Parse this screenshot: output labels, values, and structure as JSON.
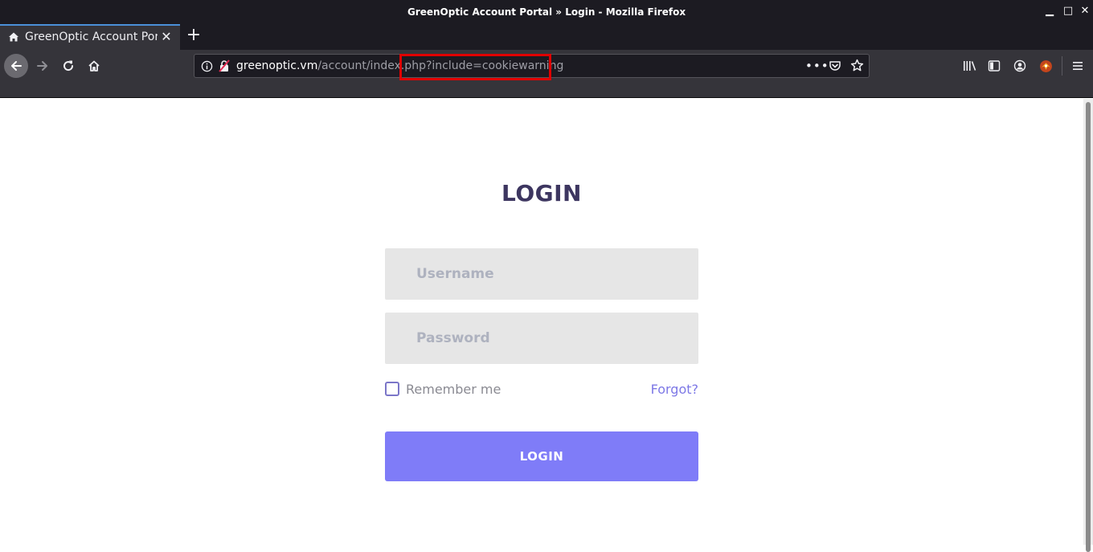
{
  "window": {
    "title": "GreenOptic Account Portal » Login - Mozilla Firefox",
    "minimize": "▁",
    "maximize": "□",
    "close": "✕"
  },
  "tab": {
    "title": "GreenOptic Account Portal » Login",
    "favicon": "home-icon",
    "close": "✕",
    "new_tab": "+"
  },
  "urlbar": {
    "host": "greenoptic.vm",
    "path": "/account/index.php?include=cookiewarning",
    "page_actions": "•••"
  },
  "page": {
    "title": "LOGIN",
    "username_placeholder": "Username",
    "password_placeholder": "Password",
    "remember_label": "Remember me",
    "forgot_label": "Forgot?",
    "login_button": "LOGIN"
  },
  "colors": {
    "accent": "#7f7cf8",
    "title": "#3d3660",
    "highlight": "#e00000"
  }
}
